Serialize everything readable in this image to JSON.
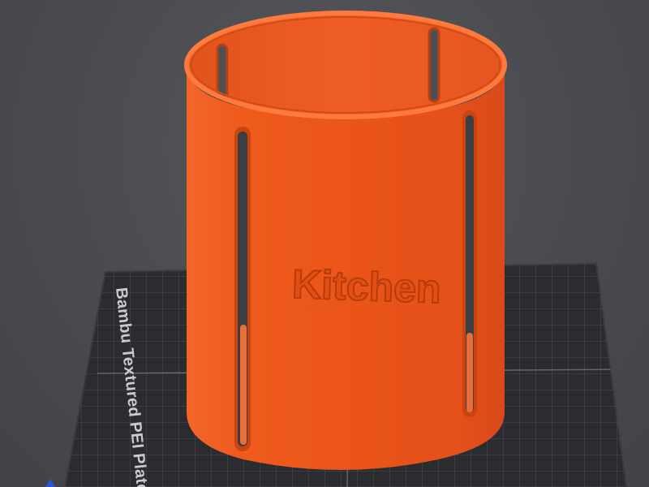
{
  "viewport": {
    "background_color": "#4b4c50"
  },
  "build_plate": {
    "label": "Bambu Textured PEI Plate",
    "color": "#2a2b2e",
    "grid_color": "#5d5e63",
    "grid_major_color": "#7a7b80"
  },
  "model": {
    "name_text": "Kitchen",
    "body_color": "#f1581c",
    "shade_color": "#c8410d",
    "highlight_color": "#fb7a3c",
    "slot_count_visible": 4
  },
  "axis_marker": {
    "icon": "axis-y-icon",
    "color": "#2b55d8"
  }
}
